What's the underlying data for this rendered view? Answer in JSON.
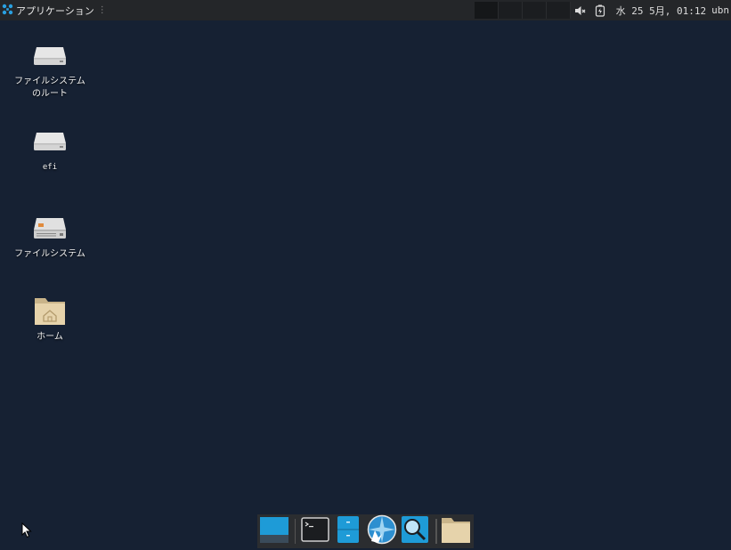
{
  "panel": {
    "app_menu_label": "アプリケーション",
    "clock": "水 25  5月, 01:12",
    "user": "ubn",
    "workspace_count": 4
  },
  "desktop": {
    "icons": [
      {
        "name": "filesystem-root",
        "label": "ファイルシステムのルート",
        "icon": "drive-icon"
      },
      {
        "name": "efi",
        "label": "efi",
        "icon": "drive-icon"
      },
      {
        "name": "filesystem",
        "label": "ファイルシステム",
        "icon": "harddisk-icon"
      },
      {
        "name": "home",
        "label": "ホーム",
        "icon": "home-folder-icon"
      }
    ]
  },
  "dock": {
    "items": [
      "show-desktop-icon",
      "terminal-icon",
      "file-manager-icon",
      "web-browser-icon",
      "search-icon",
      "folder-icon"
    ]
  },
  "colors": {
    "desktop_bg": "#162133",
    "panel_bg": "#242629",
    "accent": "#1e9bd7"
  }
}
